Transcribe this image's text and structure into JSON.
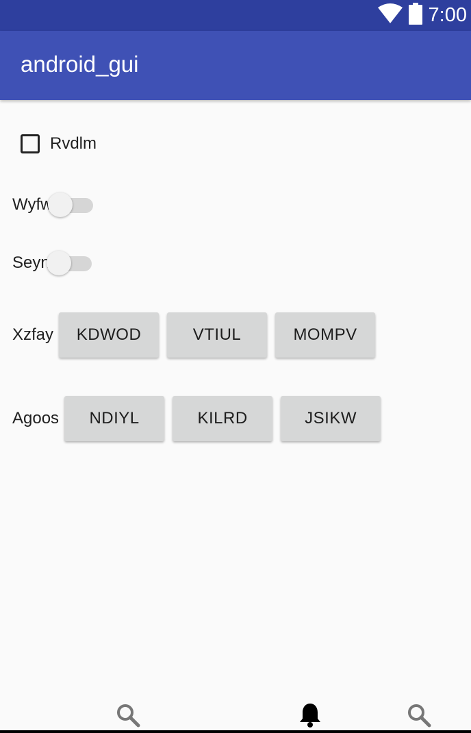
{
  "status_bar": {
    "time": "7:00",
    "icons": [
      "wifi-icon",
      "battery-icon"
    ]
  },
  "app_bar": {
    "title": "android_gui"
  },
  "checkbox": {
    "label": "Rvdlm",
    "checked": false
  },
  "switches": [
    {
      "label": "Wyfwo",
      "on": false
    },
    {
      "label": "Seynq",
      "on": false
    }
  ],
  "button_rows": [
    {
      "label": "Xzfay",
      "buttons": [
        "KDWOD",
        "VTIUL",
        "MOMPV"
      ]
    },
    {
      "label": "Agoos",
      "buttons": [
        "NDIYL",
        "KILRD",
        "JSIKW"
      ]
    }
  ],
  "bottom_nav": {
    "items": [
      "search-icon",
      "bell-icon",
      "search-icon"
    ]
  },
  "colors": {
    "status_bar": "#2e3f9e",
    "app_bar": "#3f51b5",
    "background": "#fafafa",
    "button": "#d6d7d7"
  }
}
